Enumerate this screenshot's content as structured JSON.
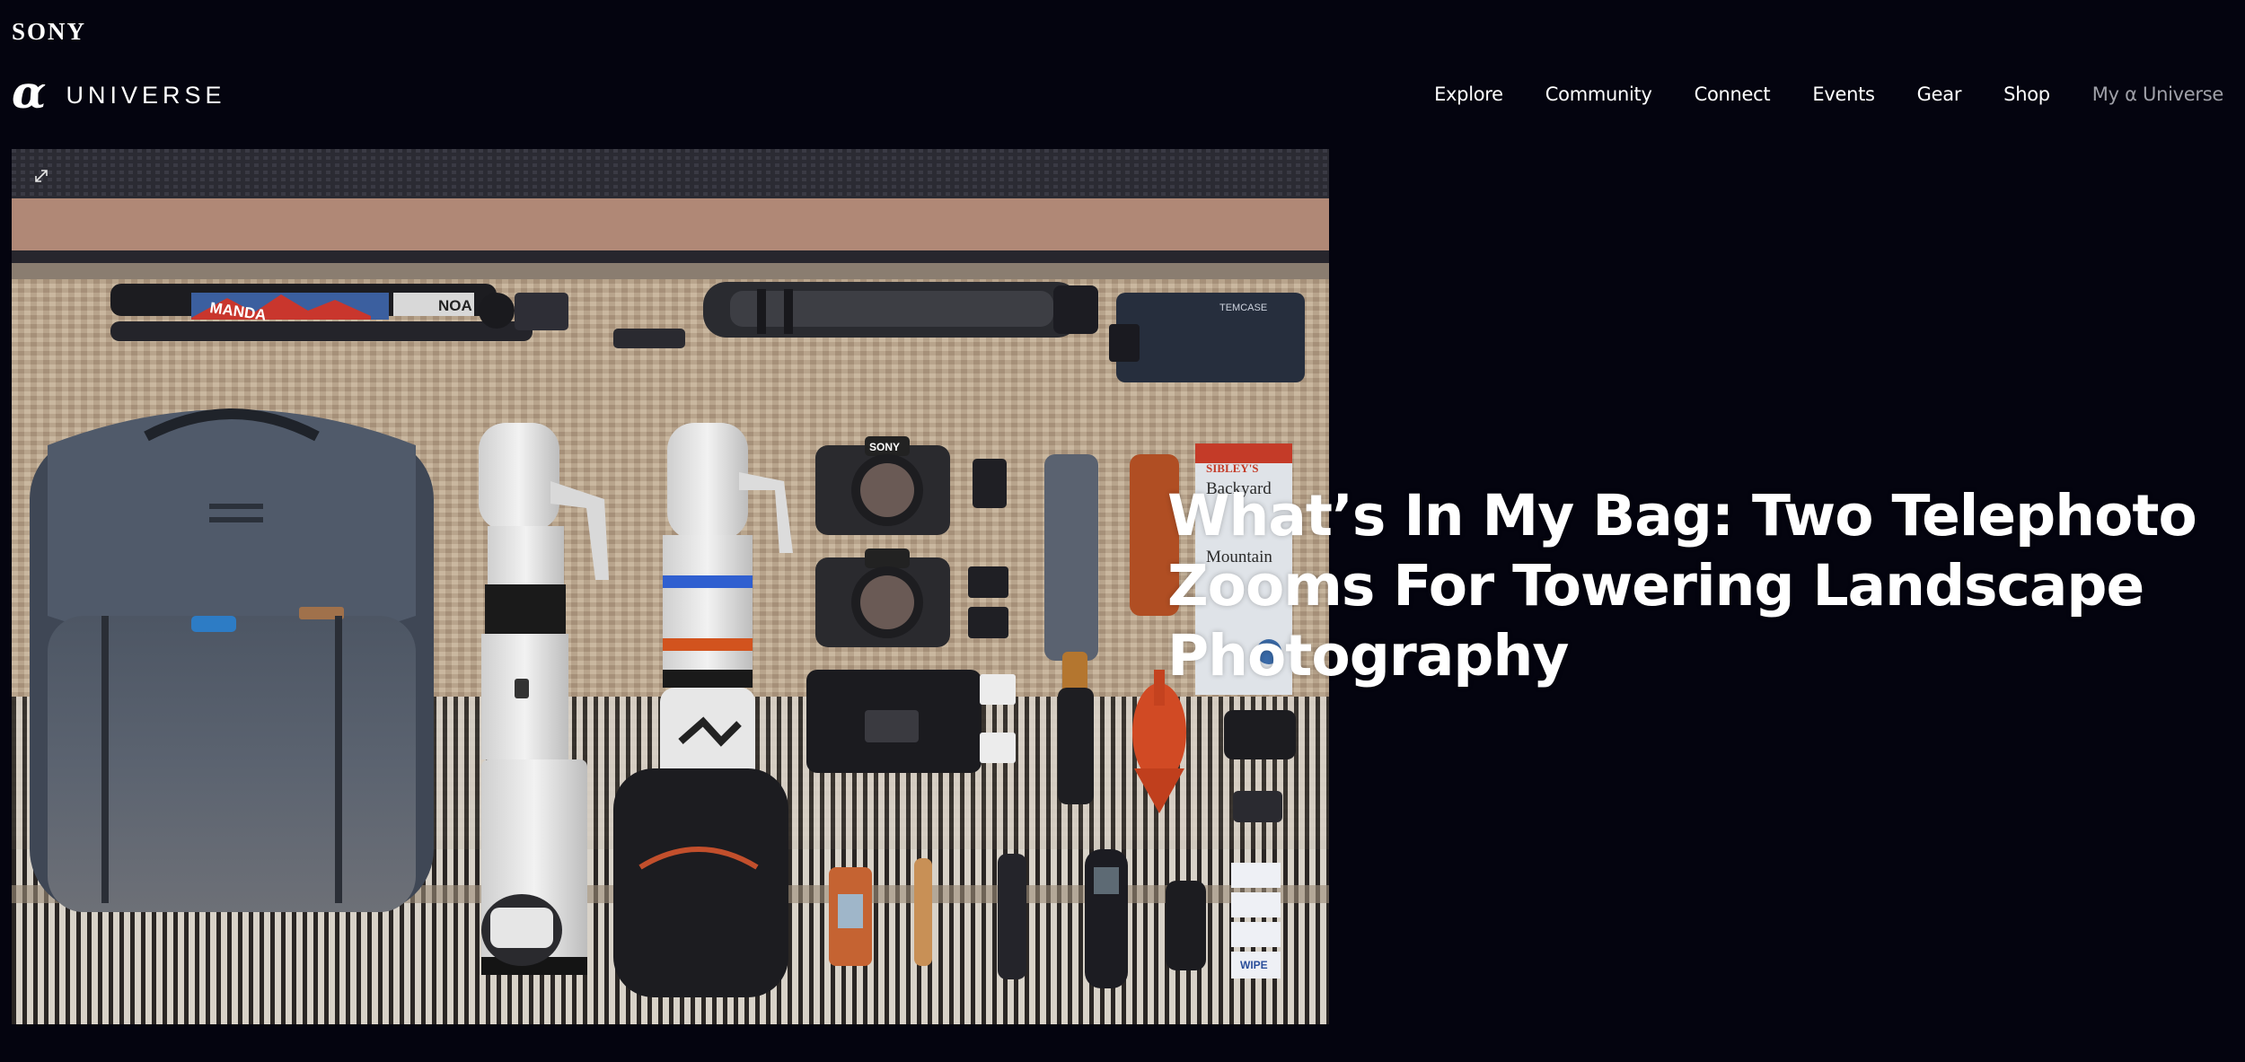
{
  "header": {
    "sony_logo": "SONY",
    "brand_symbol": "α",
    "brand_word": "UNIVERSE"
  },
  "nav": {
    "items": [
      {
        "label": "Explore"
      },
      {
        "label": "Community"
      },
      {
        "label": "Connect"
      },
      {
        "label": "Events"
      },
      {
        "label": "Gear"
      },
      {
        "label": "Shop"
      },
      {
        "label": "My α Universe"
      }
    ]
  },
  "hero": {
    "expand_icon": "expand-icon"
  },
  "article": {
    "title": "What’s In My Bag: Two Telephoto Zooms For Towering Landscape Photography"
  },
  "photo_text": {
    "tripod_brand_1": "MANDA",
    "tripod_brand_2": "NOA",
    "book_top": "SIBLEY'S",
    "book_title_1": "Backyard",
    "book_title_2": "Mountain",
    "lens_brand": "SONY",
    "wipes": "WIPE",
    "case_label": "TEMCASE"
  },
  "colors": {
    "background": "#04040f",
    "text": "#ffffff",
    "muted_nav": "#9fa0a8"
  }
}
